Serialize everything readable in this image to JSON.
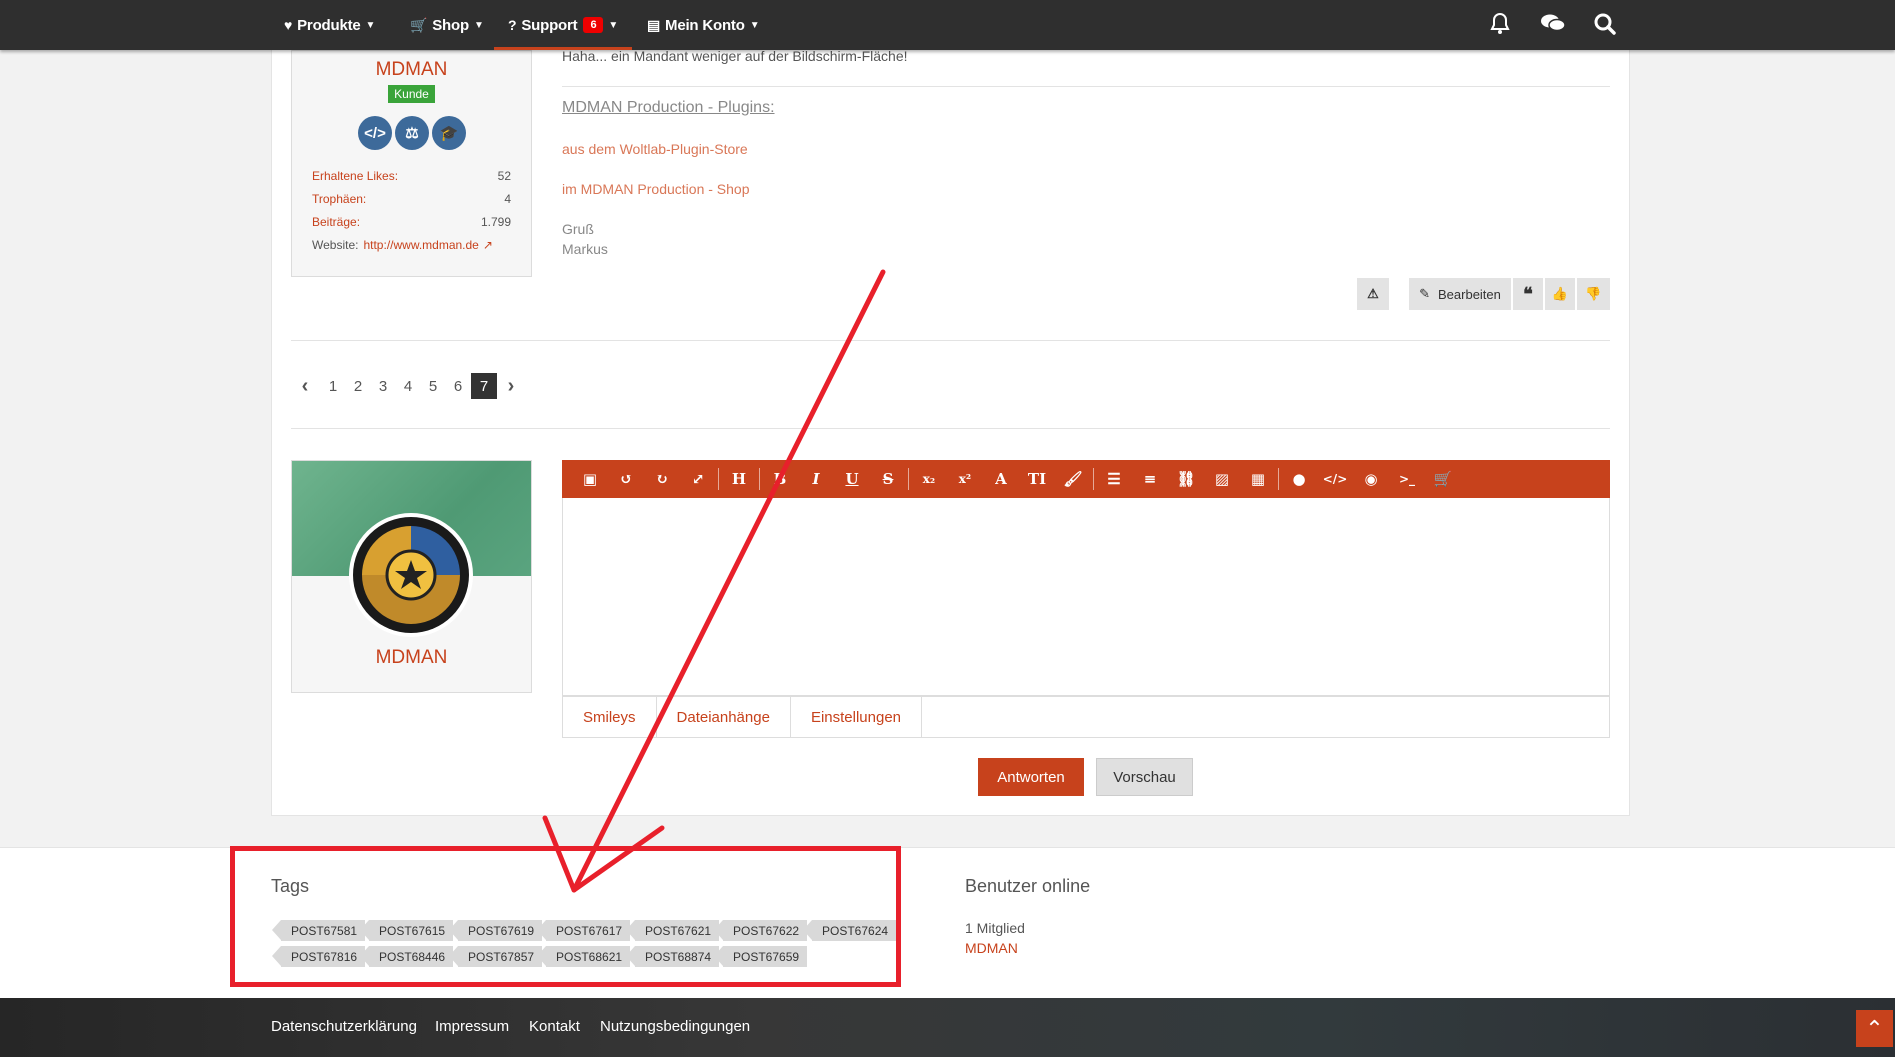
{
  "nav": {
    "produkte": "Produkte",
    "shop": "Shop",
    "support": "Support",
    "support_count": "6",
    "konto": "Mein Konto"
  },
  "author": {
    "name": "MDMAN",
    "badge": "Kunde",
    "stats": [
      {
        "k": "Erhaltene Likes:",
        "v": "52"
      },
      {
        "k": "Trophäen:",
        "v": "4"
      },
      {
        "k": "Beiträge:",
        "v": "1.799"
      }
    ],
    "website_label": "Website:",
    "website": "http://www.mdman.de"
  },
  "post": {
    "line1": "Haha... ein Mandant weniger auf der Bildschirm-Fläche!",
    "heading": "MDMAN Production - Plugins:",
    "link1": "aus dem Woltlab-Plugin-Store",
    "link2": "im MDMAN Production - Shop",
    "greet1": "Gruß",
    "greet2": "Markus",
    "edit_label": "Bearbeiten"
  },
  "pagination": [
    "1",
    "2",
    "3",
    "4",
    "5",
    "6",
    "7"
  ],
  "pagination_current": "7",
  "reply": {
    "author": "MDMAN",
    "tabs": [
      "Smileys",
      "Dateianhänge",
      "Einstellungen"
    ],
    "submit": "Antworten",
    "preview": "Vorschau"
  },
  "tags": {
    "title": "Tags",
    "row1": [
      "POST67581",
      "POST67615",
      "POST67619",
      "POST67617",
      "POST67621",
      "POST67622",
      "POST67624"
    ],
    "row2": [
      "POST67816",
      "POST68446",
      "POST67857",
      "POST68621",
      "POST68874",
      "POST67659"
    ]
  },
  "online": {
    "title": "Benutzer online",
    "count": "1 Mitglied",
    "user": "MDMAN"
  },
  "footer": {
    "links": [
      "Datenschutzerklärung",
      "Impressum",
      "Kontakt",
      "Nutzungsbedingungen"
    ]
  },
  "colors": {
    "accent": "#c7421c",
    "annotation": "#e8202b",
    "badge": "#3aa43a"
  }
}
